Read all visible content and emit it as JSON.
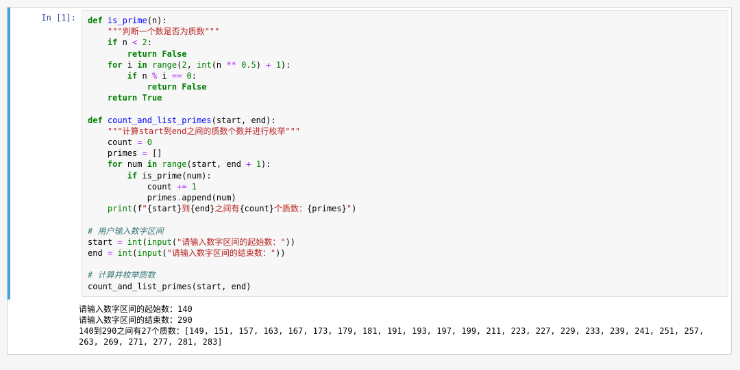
{
  "cell": {
    "prompt_label": "In [1]:",
    "code_tokens": [
      [
        "kw",
        "def"
      ],
      [
        "plain",
        " "
      ],
      [
        "fn",
        "is_prime"
      ],
      [
        "plain",
        "(n):"
      ],
      [
        "nl",
        ""
      ],
      [
        "plain",
        "    "
      ],
      [
        "str",
        "\"\"\"判断一个数是否为质数\"\"\""
      ],
      [
        "nl",
        ""
      ],
      [
        "plain",
        "    "
      ],
      [
        "kw",
        "if"
      ],
      [
        "plain",
        " n "
      ],
      [
        "op",
        "<"
      ],
      [
        "plain",
        " "
      ],
      [
        "num",
        "2"
      ],
      [
        "plain",
        ":"
      ],
      [
        "nl",
        ""
      ],
      [
        "plain",
        "        "
      ],
      [
        "kw",
        "return"
      ],
      [
        "plain",
        " "
      ],
      [
        "kw",
        "False"
      ],
      [
        "nl",
        ""
      ],
      [
        "plain",
        "    "
      ],
      [
        "kw",
        "for"
      ],
      [
        "plain",
        " i "
      ],
      [
        "kw",
        "in"
      ],
      [
        "plain",
        " "
      ],
      [
        "bi",
        "range"
      ],
      [
        "plain",
        "("
      ],
      [
        "num",
        "2"
      ],
      [
        "plain",
        ", "
      ],
      [
        "bi",
        "int"
      ],
      [
        "plain",
        "(n "
      ],
      [
        "op",
        "**"
      ],
      [
        "plain",
        " "
      ],
      [
        "num",
        "0.5"
      ],
      [
        "plain",
        ") "
      ],
      [
        "op",
        "+"
      ],
      [
        "plain",
        " "
      ],
      [
        "num",
        "1"
      ],
      [
        "plain",
        "):"
      ],
      [
        "nl",
        ""
      ],
      [
        "plain",
        "        "
      ],
      [
        "kw",
        "if"
      ],
      [
        "plain",
        " n "
      ],
      [
        "op",
        "%"
      ],
      [
        "plain",
        " i "
      ],
      [
        "op",
        "=="
      ],
      [
        "plain",
        " "
      ],
      [
        "num",
        "0"
      ],
      [
        "plain",
        ":"
      ],
      [
        "nl",
        ""
      ],
      [
        "plain",
        "            "
      ],
      [
        "kw",
        "return"
      ],
      [
        "plain",
        " "
      ],
      [
        "kw",
        "False"
      ],
      [
        "nl",
        ""
      ],
      [
        "plain",
        "    "
      ],
      [
        "kw",
        "return"
      ],
      [
        "plain",
        " "
      ],
      [
        "kw",
        "True"
      ],
      [
        "nl",
        ""
      ],
      [
        "nl",
        ""
      ],
      [
        "kw",
        "def"
      ],
      [
        "plain",
        " "
      ],
      [
        "fn",
        "count_and_list_primes"
      ],
      [
        "plain",
        "(start, end):"
      ],
      [
        "nl",
        ""
      ],
      [
        "plain",
        "    "
      ],
      [
        "str",
        "\"\"\"计算start到end之间的质数个数并进行枚举\"\"\""
      ],
      [
        "nl",
        ""
      ],
      [
        "plain",
        "    count "
      ],
      [
        "op",
        "="
      ],
      [
        "plain",
        " "
      ],
      [
        "num",
        "0"
      ],
      [
        "nl",
        ""
      ],
      [
        "plain",
        "    primes "
      ],
      [
        "op",
        "="
      ],
      [
        "plain",
        " []"
      ],
      [
        "nl",
        ""
      ],
      [
        "plain",
        "    "
      ],
      [
        "kw",
        "for"
      ],
      [
        "plain",
        " num "
      ],
      [
        "kw",
        "in"
      ],
      [
        "plain",
        " "
      ],
      [
        "bi",
        "range"
      ],
      [
        "plain",
        "(start, end "
      ],
      [
        "op",
        "+"
      ],
      [
        "plain",
        " "
      ],
      [
        "num",
        "1"
      ],
      [
        "plain",
        "):"
      ],
      [
        "nl",
        ""
      ],
      [
        "plain",
        "        "
      ],
      [
        "kw",
        "if"
      ],
      [
        "plain",
        " is_prime(num):"
      ],
      [
        "nl",
        ""
      ],
      [
        "plain",
        "            count "
      ],
      [
        "op",
        "+="
      ],
      [
        "plain",
        " "
      ],
      [
        "num",
        "1"
      ],
      [
        "nl",
        ""
      ],
      [
        "plain",
        "            primes"
      ],
      [
        "op",
        "."
      ],
      [
        "plain",
        "append(num)"
      ],
      [
        "nl",
        ""
      ],
      [
        "plain",
        "    "
      ],
      [
        "bi",
        "print"
      ],
      [
        "plain",
        "(f"
      ],
      [
        "str",
        "\""
      ],
      [
        "plain",
        "{start}"
      ],
      [
        "str",
        "到"
      ],
      [
        "plain",
        "{end}"
      ],
      [
        "str",
        "之间有"
      ],
      [
        "plain",
        "{count}"
      ],
      [
        "str",
        "个质数："
      ],
      [
        "plain",
        "{primes}"
      ],
      [
        "str",
        "\""
      ],
      [
        "plain",
        ")"
      ],
      [
        "nl",
        ""
      ],
      [
        "nl",
        ""
      ],
      [
        "cm",
        "# 用户输入数字区间"
      ],
      [
        "nl",
        ""
      ],
      [
        "plain",
        "start "
      ],
      [
        "op",
        "="
      ],
      [
        "plain",
        " "
      ],
      [
        "bi",
        "int"
      ],
      [
        "plain",
        "("
      ],
      [
        "bi",
        "input"
      ],
      [
        "plain",
        "("
      ],
      [
        "str",
        "\"请输入数字区间的起始数：\""
      ],
      [
        "plain",
        "))"
      ],
      [
        "nl",
        ""
      ],
      [
        "plain",
        "end "
      ],
      [
        "op",
        "="
      ],
      [
        "plain",
        " "
      ],
      [
        "bi",
        "int"
      ],
      [
        "plain",
        "("
      ],
      [
        "bi",
        "input"
      ],
      [
        "plain",
        "("
      ],
      [
        "str",
        "\"请输入数字区间的结束数：\""
      ],
      [
        "plain",
        "))"
      ],
      [
        "nl",
        ""
      ],
      [
        "nl",
        ""
      ],
      [
        "cm",
        "# 计算并枚举质数"
      ],
      [
        "nl",
        ""
      ],
      [
        "plain",
        "count_and_list_primes(start, end)"
      ]
    ],
    "output_lines": [
      "请输入数字区间的起始数：140",
      "请输入数字区间的结束数：290",
      "140到290之间有27个质数：[149, 151, 157, 163, 167, 173, 179, 181, 191, 193, 197, 199, 211, 223, 227, 229, 233, 239, 241, 251, 257, 263, 269, 271, 277, 281, 283]"
    ]
  }
}
